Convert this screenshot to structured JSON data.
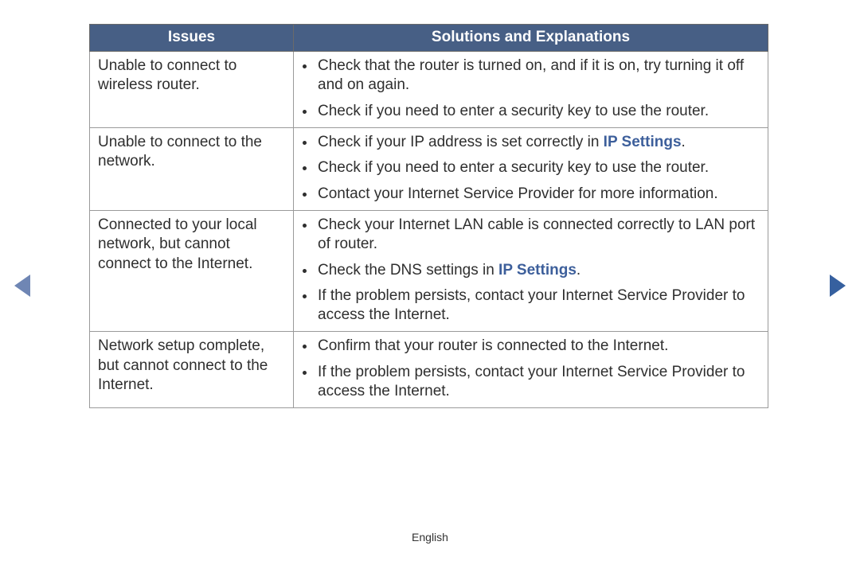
{
  "headers": {
    "issues": "Issues",
    "solutions": "Solutions and Explanations"
  },
  "link_label": "IP Settings",
  "rows": [
    {
      "issue": "Unable to connect to wireless router.",
      "solutions": [
        {
          "text": "Check that the router is turned on, and if it is on, try turning it off and on again."
        },
        {
          "text": "Check if you need to enter a security key to use the router."
        }
      ]
    },
    {
      "issue": "Unable to connect to the network.",
      "solutions": [
        {
          "text_pre": "Check if your IP address is set correctly in ",
          "link": true,
          "text_post": "."
        },
        {
          "text": "Check if you need to enter a security key to use the router."
        },
        {
          "text": "Contact your Internet Service Provider for more information."
        }
      ]
    },
    {
      "issue": "Connected to your local network, but cannot connect to the Internet.",
      "solutions": [
        {
          "text": "Check your Internet LAN cable is connected correctly to LAN port of router."
        },
        {
          "text_pre": "Check the DNS settings in ",
          "link": true,
          "text_post": "."
        },
        {
          "text": "If the problem persists, contact your Internet Service Provider to access the Internet."
        }
      ]
    },
    {
      "issue": "Network setup complete, but cannot connect to the Internet.",
      "solutions": [
        {
          "text": "Confirm that your router is connected to the Internet."
        },
        {
          "text": "If the problem persists, contact your Internet Service Provider to access the Internet."
        }
      ]
    }
  ],
  "footer": {
    "language": "English"
  }
}
